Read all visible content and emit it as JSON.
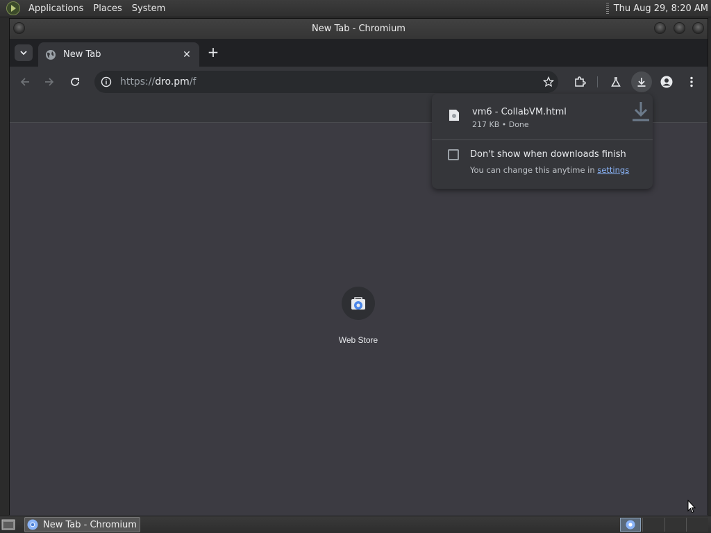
{
  "desktop": {
    "menus": [
      "Applications",
      "Places",
      "System"
    ],
    "clock": "Thu Aug 29,  8:20 AM"
  },
  "window": {
    "title": "New Tab - Chromium"
  },
  "tabs": [
    {
      "title": "New Tab"
    }
  ],
  "toolbar": {
    "url_scheme": "https://",
    "url_host": "dro.pm",
    "url_path": "/f"
  },
  "content": {
    "shortcut_label": "Web Store"
  },
  "download_bubble": {
    "file_name": "vm6 - CollabVM.html",
    "file_status": "217 KB • Done",
    "option_label": "Don't show when downloads finish",
    "hint_text": "You can change this anytime in ",
    "hint_link": "settings",
    "option_checked": false
  },
  "taskbar": {
    "task_title": "New Tab - Chromium"
  },
  "colors": {
    "page_background": "#3c3b42",
    "toolbar": "#35363a",
    "link": "#8ab4f8"
  }
}
